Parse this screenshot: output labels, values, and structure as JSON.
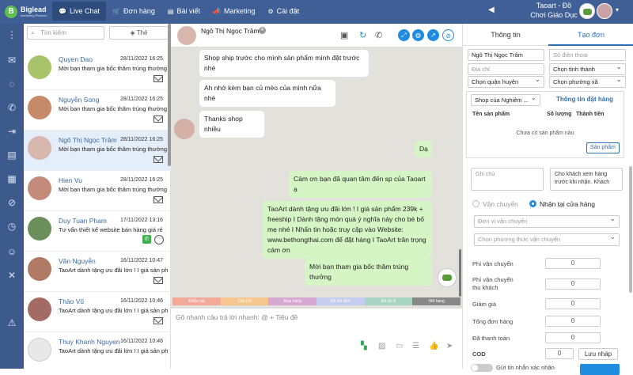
{
  "app": {
    "logo_letter": "B",
    "logo_name": "Biglead",
    "logo_tagline": "Marketing Platform"
  },
  "nav": [
    {
      "icon": "💬",
      "label": "Live Chat"
    },
    {
      "icon": "🛒",
      "label": "Đơn hàng"
    },
    {
      "icon": "▤",
      "label": "Bài viết"
    },
    {
      "icon": "📣",
      "label": "Marketing"
    },
    {
      "icon": "⚙",
      "label": "Cài đặt"
    }
  ],
  "shop": {
    "name": "Taoart - Đồ Chơi Giáo Dục"
  },
  "list": {
    "search_placeholder": "Tìm kiếm",
    "tag_button": "Thẻ",
    "conversations": [
      {
        "name": "Quyen Dao",
        "time": "28/11/2022 16:25",
        "msg": "Mời bạn tham gia bốc thăm trúng thưởng",
        "color": "#a7c46a"
      },
      {
        "name": "Nguyễn Song",
        "time": "28/11/2022 16:25",
        "msg": "Mời bạn tham gia bốc thăm trúng thưởng",
        "color": "#c58a6a"
      },
      {
        "name": "Ngô Thị Ngọc Trâm",
        "time": "28/11/2022 16:25",
        "msg": "Mời bạn tham gia bốc thăm trúng thưởng",
        "color": "#d7b7ae"
      },
      {
        "name": "Hien Vu",
        "time": "28/11/2022 16:25",
        "msg": "Mời bạn tham gia bốc thăm trúng thưởng",
        "color": "#c48b7a"
      },
      {
        "name": "Duy Tuan Pham",
        "time": "17/11/2022 13:16",
        "msg": "Tư vấn thiết kế website bán hàng giá rẻ",
        "color": "#6b8f5a"
      },
      {
        "name": "Văn Nguyễn",
        "time": "16/11/2022 10:47",
        "msg": "TaoArt dành tặng ưu đãi lớn ! I giá sản phẩm",
        "color": "#b07a66"
      },
      {
        "name": "Thảo Vũ",
        "time": "16/11/2022 10:46",
        "msg": "TaoArt dành tặng ưu đãi lớn ! I giá sản phẩm",
        "color": "#a36b63"
      },
      {
        "name": "Thuy Khanh Nguyen",
        "time": "16/11/2022 10:46",
        "msg": "TaoArt dành tặng ưu đãi lớn ! I giá sản phẩm",
        "color": "#e8e8e8"
      }
    ]
  },
  "chat": {
    "contact_name": "Ngô Thị Ngọc Trâm",
    "messages": [
      {
        "text": "Shop ship trước cho mình sản phẩm mình đặt trước nhé",
        "dir": "in"
      },
      {
        "text": "Ah nhớ kèm bạn củ mèo của mình nữa nhé",
        "dir": "in"
      },
      {
        "text": "Thanks shop nhiều",
        "dir": "in"
      },
      {
        "text": "Dạ",
        "dir": "out"
      },
      {
        "text": "Cảm ơn bạn đã quan tâm đến sp của Taoart ạ",
        "dir": "out"
      },
      {
        "text": "TaoArt dành tặng ưu đãi lớn ! I giá sản phẩm 239k + freeship I Dành tặng món quà ý nghĩa này cho bé bố mẹ nhé I Nhấn tin hoặc truy cập vào Website: www.bethongthai.com để đặt hàng I TaoArt trân trọng cảm ơn",
        "dir": "out"
      },
      {
        "text": "Mời bạn tham gia bốc thăm trúng thưởng",
        "dir": "out"
      }
    ],
    "tags": [
      {
        "label": "Khiếu nại",
        "color": "#f2a99a"
      },
      {
        "label": "Câu hỏi",
        "color": "#f5c78e"
      },
      {
        "label": "Mua hàng",
        "color": "#d7a8d2"
      },
      {
        "label": "Đã lên đơn",
        "color": "#c4cdf0"
      },
      {
        "label": "Đã xử lý",
        "color": "#a8d4c4"
      },
      {
        "label": "Hết hàng",
        "color": "#888888"
      }
    ],
    "input_placeholder": "Gõ nhanh câu trả lời nhanh: @ + Tiêu đề"
  },
  "order": {
    "tabs": [
      "Thông tin",
      "Tạo đơn"
    ],
    "name_value": "Ngô Thị Ngọc Trâm",
    "phone_placeholder": "Số điện thoại",
    "address_placeholder": "Địa chỉ",
    "province_placeholder": "Chọn tỉnh thành",
    "district_placeholder": "Chọn quận huyện",
    "ward_placeholder": "Chọn phường xã",
    "shop_select": "Shop của Nghiêm ...",
    "order_info_title": "Thông tin đặt hàng",
    "col_product": "Tên sản phẩm",
    "col_qty": "Số lượng",
    "col_total": "Thành tiền",
    "empty_text": "Chưa có sản phẩm nào",
    "product_button": "Sản phẩm",
    "note_placeholder": "Ghi chú",
    "customer_note": "Cho khách xem hàng trước khi nhận. Khách",
    "ship_option": "Vận chuyển",
    "pickup_option": "Nhận tại cửa hàng",
    "carrier_placeholder": "Đơn vị vận chuyển",
    "ship_method_placeholder": "Chọn phương thức vận chuyển",
    "fee_label": "Phí vận chuyển",
    "fee_value": "0",
    "customer_fee_label": "Phí vận chuyển thu khách",
    "customer_fee_value": "0",
    "discount_label": "Giảm giá",
    "discount_value": "0",
    "total_label": "Tổng đơn hàng",
    "total_value": "0",
    "paid_label": "Đã thanh toán",
    "paid_value": "0",
    "cod_label": "COD",
    "cod_value": "0",
    "draft_button": "Lưu nháp",
    "bottom_text": "Gửi tin nhắn xác nhận"
  }
}
